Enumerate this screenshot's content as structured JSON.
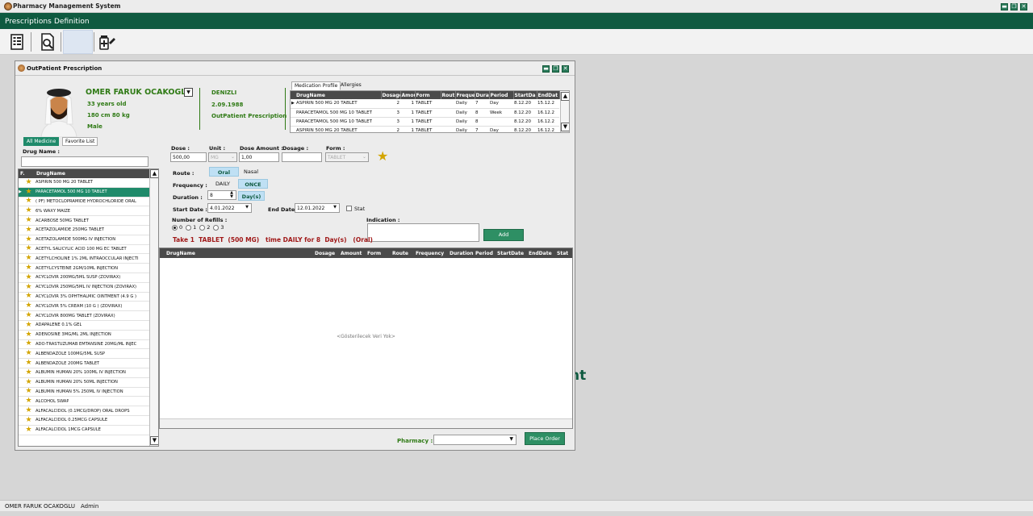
{
  "app": {
    "title": "Pharmacy Management System"
  },
  "menu": [
    {
      "label": "Prescriptions"
    },
    {
      "label": "Definition"
    }
  ],
  "window_controls": {
    "minimize": "▬",
    "restore": "❐",
    "close": "✕"
  },
  "background_text": "nt",
  "dialog": {
    "title": "OutPatient Prescription"
  },
  "patient": {
    "name": "OMER FARUK OCAKOGLU",
    "age": "33 years old",
    "size": "180 cm 80 kg",
    "gender": "Male",
    "city": "DENIZLI",
    "date": "2.09.1988",
    "type": "OutPatient Prescription"
  },
  "profile_tabs": [
    {
      "label": "Medication Profile"
    },
    {
      "label": "Allergies"
    }
  ],
  "profile_table": {
    "columns": [
      "DrugName",
      "Dosage",
      "Amou",
      "Form",
      "Rout",
      "Freque",
      "Durat",
      "Period",
      "StartDa",
      "EndDat"
    ],
    "rows": [
      [
        "ASPIRIN 500 MG 20 TABLET",
        "2",
        "1",
        "TABLET",
        "",
        "Daily",
        "7",
        "Day",
        "8.12.20",
        "15.12.2"
      ],
      [
        "PARACETAMOL 500 MG 10 TABLET",
        "3",
        "1",
        "TABLET",
        "",
        "Daily",
        "8",
        "Week",
        "8.12.20",
        "16.12.2"
      ],
      [
        "PARACETAMOL 500 MG 10 TABLET",
        "3",
        "1",
        "TABLET",
        "",
        "Daily",
        "8",
        "",
        "8.12.20",
        "16.12.2"
      ],
      [
        "ASPIRIN 500 MG 20 TABLET",
        "2",
        "1",
        "TABLET",
        "",
        "Daily",
        "7",
        "Day",
        "8.12.20",
        "16.12.2"
      ]
    ]
  },
  "medicine_tabs": [
    {
      "label": "All Medicine"
    },
    {
      "label": "Favorite List"
    }
  ],
  "drug_search": {
    "label": "Drug Name :",
    "value": ""
  },
  "medicine_list": {
    "columns": [
      "F.",
      "DrugName"
    ],
    "items": [
      "ASPIRIN 500 MG 20 TABLET",
      "PARACETAMOL 500 MG 10 TABLET",
      "( PF) METOCLOPRAMIDE HYDROCHLORIDE ORAL",
      "6% WAXY MAIZE",
      "ACARBOSE 50MG TABLET",
      "ACETAZOLAMIDE 250MG TABLET",
      "ACETAZOLAMIDE 500MG IV INJECTION",
      "ACETYL SALICYLIC ACID 100 MG EC TABLET",
      "ACETYLCHOLINE 1% 2ML INTRAOCCULAR INJECTI",
      "ACETYLCYSTEINE 2GM/10ML INJECTION",
      "ACYCLOVIR 200MG/5ML SUSP (ZOVIRAX)",
      "ACYCLOVIR 250MG/5ML IV INJECTION (ZOVIRAX)",
      "ACYCLOVIR 3% OPHTHALMIC OINTMENT (4.9 G )",
      "ACYCLOVIR 5% CREAM (10 G ) (ZOVIRAX)",
      "ACYCLOVIR 800MG TABLET (ZOVIRAX)",
      "ADAPALENE 0.1% GEL",
      "ADENOSINE 3MG/ML 2ML INJECTION",
      "ADO-TRASTUZUMAB EMTANSINE 20MG/ML INJEC",
      "ALBENDAZOLE 100MG/5ML SUSP",
      "ALBENDAZOLE 200MG TABLET",
      "ALBUMIN HUMAN 20% 100ML IV INJECTION",
      "ALBUMIN HUMAN 20% 50ML INJECTION",
      "ALBUMIN HUMAN 5% 250ML IV INJECTION",
      "ALCOHOL SWAP",
      "ALFACALCIDOL (0.1MCG/DROP) ORAL DROPS",
      "ALFACALCIDOL 0.25MCG CAPSULE",
      "ALFACALCIDOL 1MCG CAPSULE"
    ],
    "selected_index": 1
  },
  "form": {
    "dose_label": "Dose :",
    "dose_value": "500,00",
    "unit_label": "Unit :",
    "unit_value": "MG",
    "dose_amount_label": "Dose Amount :",
    "dose_amount_value": "1,00",
    "dosage_label": "Dosage :",
    "dosage_value": "",
    "form_label": "Form :",
    "form_value": "TABLET",
    "route_label": "Route :",
    "route_oral": "Oral",
    "route_nasal": "Nasal",
    "frequency_label": "Frequency :",
    "freq_daily": "DAILY",
    "freq_once": "ONCE",
    "duration_label": "Duration :",
    "duration_value": "8",
    "duration_unit": "Day(s)",
    "start_date_label": "Start Date :",
    "start_date_value": "4.01.2022",
    "end_date_label": "End Date",
    "end_date_value": "12.01.2022",
    "stat_label": "Stat",
    "refills_label": "Number of Refills :",
    "refills_options": [
      "0",
      "1",
      "2",
      "3"
    ],
    "refills_selected": "0",
    "indication_label": "Indication :",
    "indication_value": "",
    "summary": "Take 1  TABLET  (500 MG)   time DAILY for 8  Day(s)   (Oral)",
    "add_label": "Add"
  },
  "order_grid": {
    "columns": [
      "DrugName",
      "Dosage",
      "Amount",
      "Form",
      "Route",
      "Frequency",
      "Duration",
      "Period",
      "StartDate",
      "EndDate",
      "Stat"
    ],
    "empty_text": "<Gösterilecek Veri Yok>"
  },
  "pharmacy": {
    "label": "Pharmacy :",
    "value": ""
  },
  "place_order_label": "Place Order",
  "status_bar": {
    "user": "OMER FARUK OCAKOGLU",
    "role": "Admin"
  },
  "colors": {
    "accent": "#0f5a40",
    "green_text": "#2f7a15",
    "selected_row": "#1f8a6a",
    "summary_red": "#a01818",
    "star": "#d3a500"
  },
  "icons": [
    "prescription-list-icon",
    "search-document-icon",
    "blank-toolbar-slot",
    "add-medicine-icon",
    "star-icon"
  ]
}
